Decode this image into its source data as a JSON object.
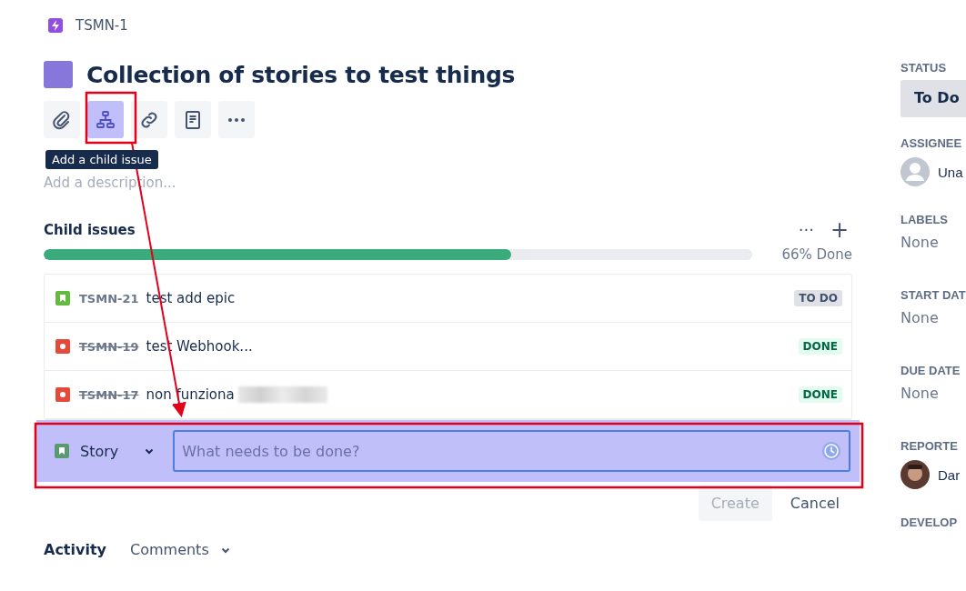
{
  "breadcrumb": {
    "key": "TSMN-1"
  },
  "title": "Collection of stories to test things",
  "toolbar": [
    {
      "kind": "attach",
      "selected": false
    },
    {
      "kind": "child",
      "selected": true
    },
    {
      "kind": "link",
      "selected": false
    },
    {
      "kind": "page",
      "selected": false
    },
    {
      "kind": "more",
      "selected": false
    }
  ],
  "tooltip": "Add a child issue",
  "description": {
    "placeholder": "Add a description..."
  },
  "child_issues": {
    "title": "Child issues",
    "more": "···",
    "add": "+",
    "level": 0.66,
    "progress_label": "66% Done",
    "items": [
      {
        "kind": "story",
        "key": "TSMN-21",
        "done": false,
        "summary": "test add epic",
        "redacted": false,
        "status": "TO DO"
      },
      {
        "kind": "bug",
        "key": "TSMN-19",
        "done": true,
        "summary": "test Webhook...",
        "redacted": false,
        "status": "DONE"
      },
      {
        "kind": "bug",
        "key": "TSMN-17",
        "done": true,
        "summary": "non funziona",
        "redacted": true,
        "status": "DONE"
      }
    ]
  },
  "create_row": {
    "type": "Story",
    "kind": "story",
    "placeholder": "What needs to be done?"
  },
  "buttons": [
    {
      "label": "Create",
      "disabled": true
    },
    {
      "label": "Cancel",
      "disabled": false
    }
  ],
  "activity": {
    "title": "Activity",
    "filter": "Comments"
  },
  "sidebar": [
    {
      "kind": "status",
      "label": "STATUS",
      "value": "To Do"
    },
    {
      "kind": "unassigned",
      "label": "ASSIGNEE",
      "value": "Una"
    },
    {
      "kind": "text",
      "label": "LABELS",
      "value": "None"
    },
    {
      "kind": "text",
      "label": "START DAT",
      "value": "None"
    },
    {
      "kind": "text",
      "label": "DUE DATE",
      "value": "None"
    },
    {
      "kind": "person",
      "label": "REPORTE",
      "value": "Dar"
    },
    {
      "kind": "heading",
      "label": "DEVELOP"
    }
  ]
}
